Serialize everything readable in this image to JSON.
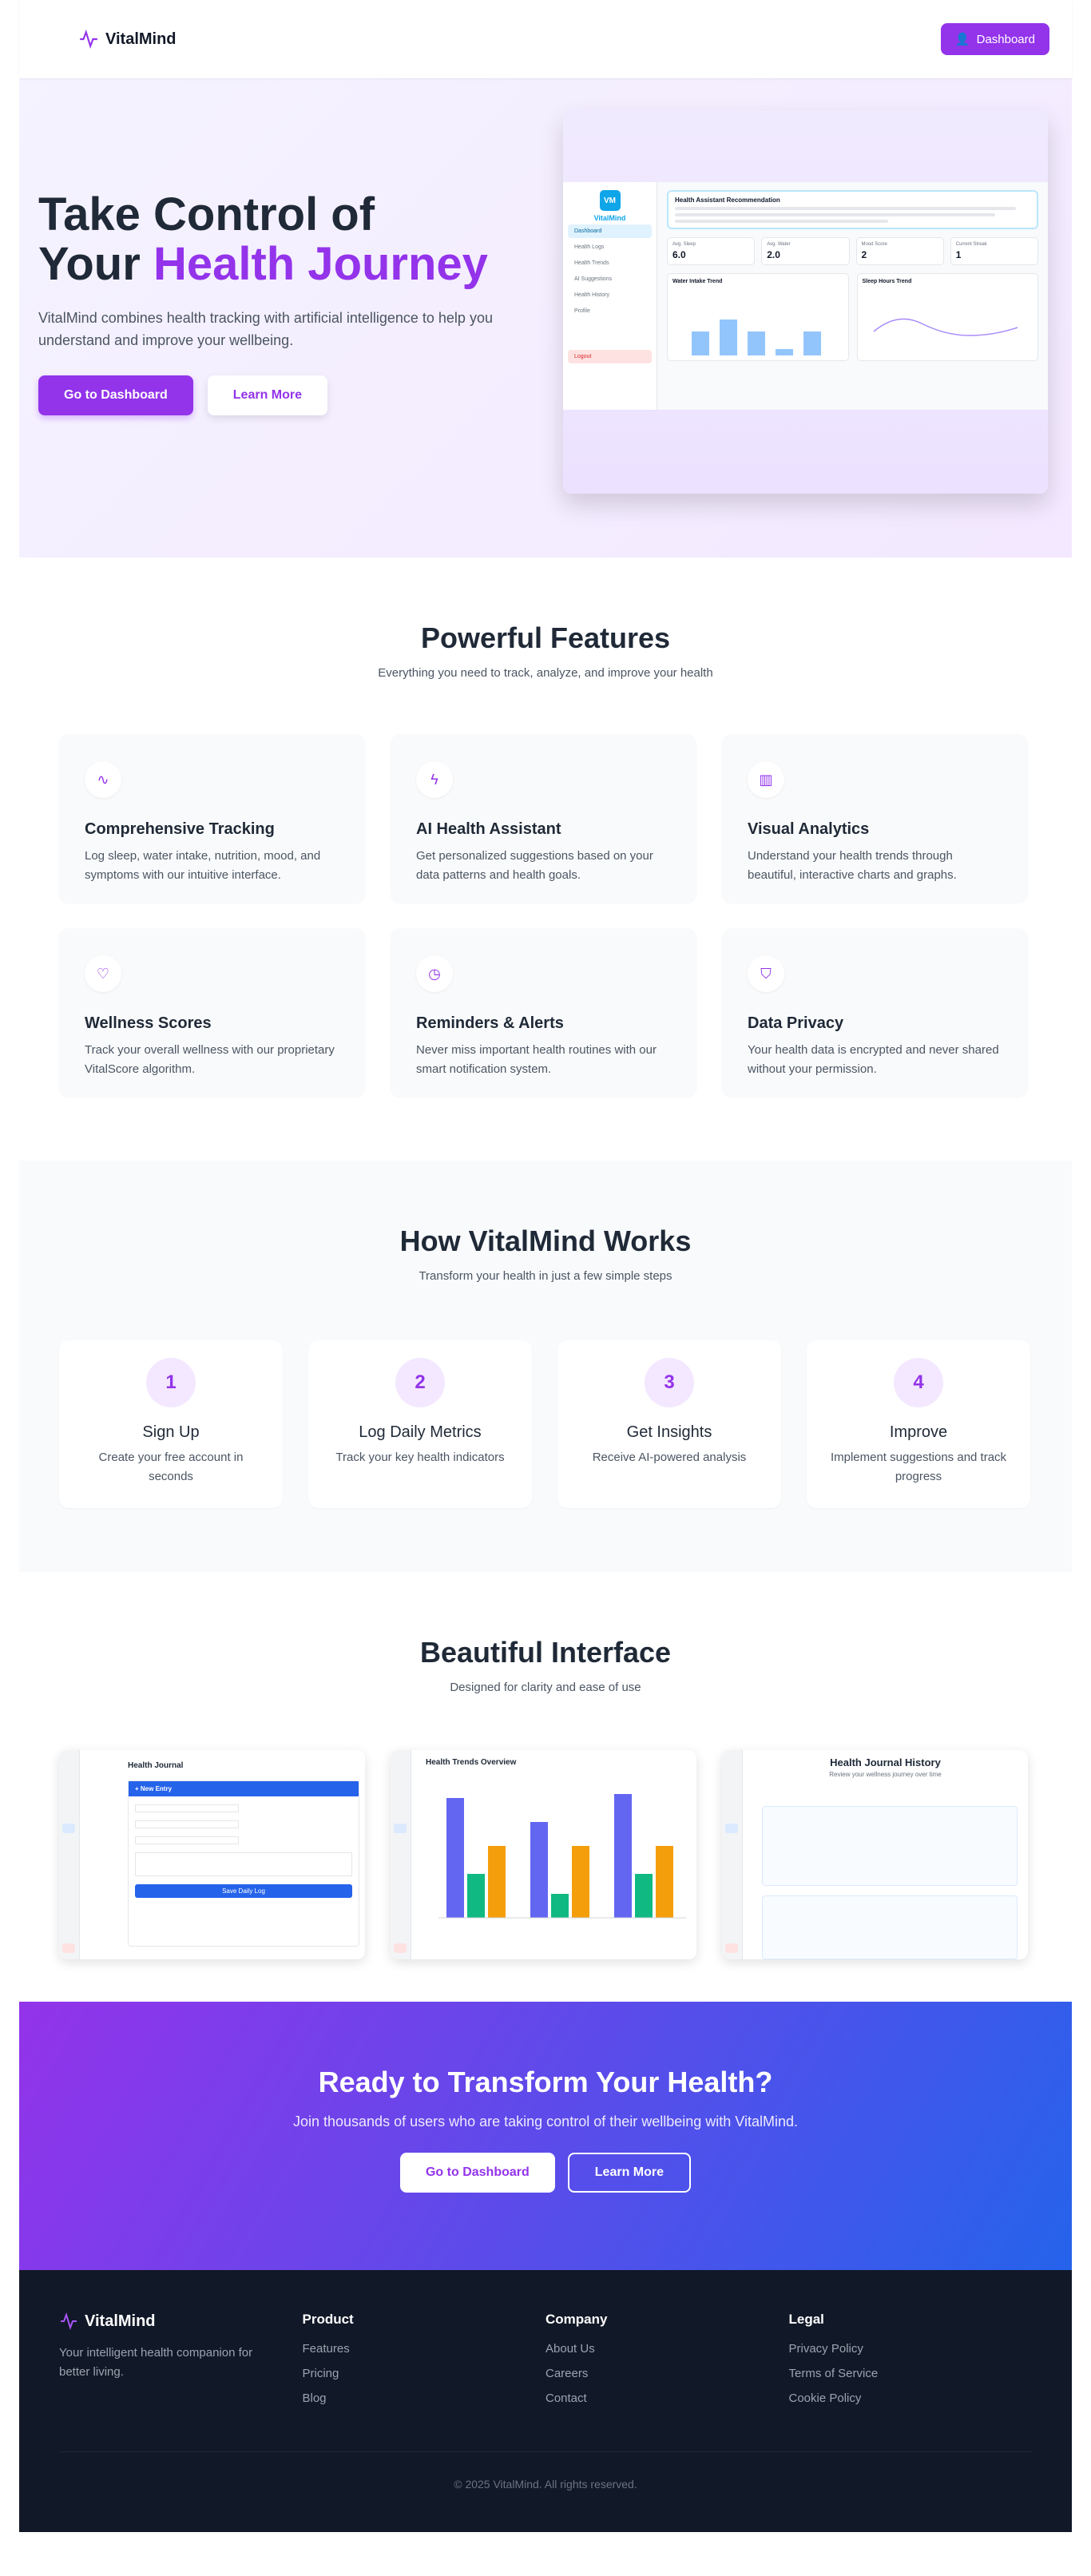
{
  "header": {
    "brand": "VitalMind",
    "dashboard_button": "Dashboard"
  },
  "hero": {
    "title_line1": "Take Control of",
    "title_line2_plain": "Your ",
    "title_line2_accent": "Health Journey",
    "description": "VitalMind combines health tracking with artificial intelligence to help you understand and improve your wellbeing.",
    "primary_button": "Go to Dashboard",
    "secondary_button": "Learn More",
    "preview": {
      "badge": "VM",
      "brand": "VitalMind",
      "nav": [
        "Dashboard",
        "Health Logs",
        "Health Trends",
        "AI Suggestions",
        "Health History",
        "Profile"
      ],
      "logout": "Logout",
      "recommendation_title": "Health Assistant Recommendation",
      "stats": [
        {
          "label": "Avg. Sleep",
          "value": "6.0"
        },
        {
          "label": "Avg. Water",
          "value": "2.0"
        },
        {
          "label": "Mood Score",
          "value": "2"
        },
        {
          "label": "Current Streak",
          "value": "1"
        }
      ],
      "chart1": "Water Intake Trend",
      "chart2": "Sleep Hours Trend"
    }
  },
  "features": {
    "title": "Powerful Features",
    "subtitle": "Everything you need to track, analyze, and improve your health",
    "items": [
      {
        "title": "Comprehensive Tracking",
        "text": "Log sleep, water intake, nutrition, mood, and symptoms with our intuitive interface.",
        "icon": "∿"
      },
      {
        "title": "AI Health Assistant",
        "text": "Get personalized suggestions based on your data patterns and health goals.",
        "icon": "ϟ"
      },
      {
        "title": "Visual Analytics",
        "text": "Understand your health trends through beautiful, interactive charts and graphs.",
        "icon": "▥"
      },
      {
        "title": "Wellness Scores",
        "text": "Track your overall wellness with our proprietary VitalScore algorithm.",
        "icon": "♡"
      },
      {
        "title": "Reminders & Alerts",
        "text": "Never miss important health routines with our smart notification system.",
        "icon": "◷"
      },
      {
        "title": "Data Privacy",
        "text": "Your health data is encrypted and never shared without your permission.",
        "icon": "⛉"
      }
    ]
  },
  "how": {
    "title": "How VitalMind Works",
    "subtitle": "Transform your health in just a few simple steps",
    "steps": [
      {
        "num": "1",
        "title": "Sign Up",
        "text": "Create your free account in seconds"
      },
      {
        "num": "2",
        "title": "Log Daily Metrics",
        "text": "Track your key health indicators"
      },
      {
        "num": "3",
        "title": "Get Insights",
        "text": "Receive AI-powered analysis"
      },
      {
        "num": "4",
        "title": "Improve",
        "text": "Implement suggestions and track progress"
      }
    ]
  },
  "interface": {
    "title": "Beautiful Interface",
    "subtitle": "Designed for clarity and ease of use",
    "shot1": {
      "title": "Health Journal",
      "entry": "+ New Entry",
      "save": "Save Daily Log"
    },
    "shot2": {
      "title": "Health Trends Overview"
    },
    "shot3": {
      "title": "Health Journal History",
      "sub": "Review your wellness journey over time"
    }
  },
  "cta": {
    "title": "Ready to Transform Your Health?",
    "subtitle": "Join thousands of users who are taking control of their wellbeing with VitalMind.",
    "primary": "Go to Dashboard",
    "secondary": "Learn More"
  },
  "footer": {
    "brand": "VitalMind",
    "tagline": "Your intelligent health companion for better living.",
    "cols": [
      {
        "title": "Product",
        "links": [
          "Features",
          "Pricing",
          "Blog"
        ]
      },
      {
        "title": "Company",
        "links": [
          "About Us",
          "Careers",
          "Contact"
        ]
      },
      {
        "title": "Legal",
        "links": [
          "Privacy Policy",
          "Terms of Service",
          "Cookie Policy"
        ]
      }
    ],
    "copyright": "© 2025 VitalMind. All rights reserved."
  },
  "colors": {
    "accent": "#9333ea",
    "blue": "#2563eb",
    "dark": "#111827"
  }
}
